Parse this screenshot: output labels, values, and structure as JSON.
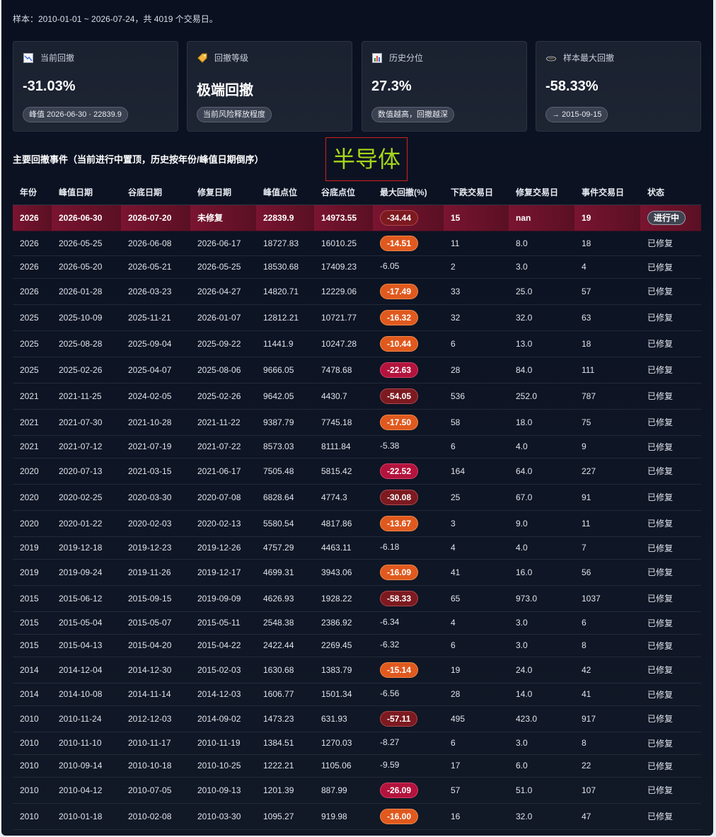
{
  "sample_text": "样本：2010-01-01 ~ 2026-07-24，共 4019 个交易日。",
  "cards": [
    {
      "title": "当前回撤",
      "icon": "chart-down-icon",
      "value": "-31.03%",
      "pill": "峰值 2026-06-30 · 22839.9"
    },
    {
      "title": "回撤等级",
      "icon": "tag-icon",
      "value": "极端回撤",
      "pill": "当前风险释放程度"
    },
    {
      "title": "历史分位",
      "icon": "bar-chart-icon",
      "value": "27.3%",
      "pill": "数值越高，回撤越深"
    },
    {
      "title": "样本最大回撤",
      "icon": "black-disc-icon",
      "value": "-58.33%",
      "pill": "→ 2015-09-15"
    }
  ],
  "section_title": "主要回撤事件（当前进行中置顶，历史按年份/峰值日期倒序）",
  "watermark": "半导体",
  "columns": [
    "年份",
    "峰值日期",
    "谷底日期",
    "修复日期",
    "峰值点位",
    "谷底点位",
    "最大回撤(%)",
    "下跌交易日",
    "修复交易日",
    "事件交易日",
    "状态"
  ],
  "rows": [
    {
      "year": "2026",
      "peak": "2026-06-30",
      "trough": "2026-07-20",
      "repair": "未修复",
      "peak_v": "22839.9",
      "trough_v": "14973.55",
      "dd": "-34.44",
      "dd_style": "dark",
      "down": "15",
      "rep": "nan",
      "evt": "19",
      "status": "进行中",
      "current": true
    },
    {
      "year": "2026",
      "peak": "2026-05-25",
      "trough": "2026-06-08",
      "repair": "2026-06-17",
      "peak_v": "18727.83",
      "trough_v": "16010.25",
      "dd": "-14.51",
      "dd_style": "orange",
      "down": "11",
      "rep": "8.0",
      "evt": "18",
      "status": "已修复"
    },
    {
      "year": "2026",
      "peak": "2026-05-20",
      "trough": "2026-05-21",
      "repair": "2026-05-25",
      "peak_v": "18530.68",
      "trough_v": "17409.23",
      "dd": "-6.05",
      "dd_style": "plain",
      "down": "2",
      "rep": "3.0",
      "evt": "4",
      "status": "已修复"
    },
    {
      "year": "2026",
      "peak": "2026-01-28",
      "trough": "2026-03-23",
      "repair": "2026-04-27",
      "peak_v": "14820.71",
      "trough_v": "12229.06",
      "dd": "-17.49",
      "dd_style": "orange",
      "down": "33",
      "rep": "25.0",
      "evt": "57",
      "status": "已修复"
    },
    {
      "year": "2025",
      "peak": "2025-10-09",
      "trough": "2025-11-21",
      "repair": "2026-01-07",
      "peak_v": "12812.21",
      "trough_v": "10721.77",
      "dd": "-16.32",
      "dd_style": "orange",
      "down": "32",
      "rep": "32.0",
      "evt": "63",
      "status": "已修复"
    },
    {
      "year": "2025",
      "peak": "2025-08-28",
      "trough": "2025-09-04",
      "repair": "2025-09-22",
      "peak_v": "11441.9",
      "trough_v": "10247.28",
      "dd": "-10.44",
      "dd_style": "orange",
      "down": "6",
      "rep": "13.0",
      "evt": "18",
      "status": "已修复"
    },
    {
      "year": "2025",
      "peak": "2025-02-26",
      "trough": "2025-04-07",
      "repair": "2025-08-06",
      "peak_v": "9666.05",
      "trough_v": "7478.68",
      "dd": "-22.63",
      "dd_style": "red",
      "down": "28",
      "rep": "84.0",
      "evt": "111",
      "status": "已修复"
    },
    {
      "year": "2021",
      "peak": "2021-11-25",
      "trough": "2024-02-05",
      "repair": "2025-02-26",
      "peak_v": "9642.05",
      "trough_v": "4430.7",
      "dd": "-54.05",
      "dd_style": "dark",
      "down": "536",
      "rep": "252.0",
      "evt": "787",
      "status": "已修复"
    },
    {
      "year": "2021",
      "peak": "2021-07-30",
      "trough": "2021-10-28",
      "repair": "2021-11-22",
      "peak_v": "9387.79",
      "trough_v": "7745.18",
      "dd": "-17.50",
      "dd_style": "orange",
      "down": "58",
      "rep": "18.0",
      "evt": "75",
      "status": "已修复"
    },
    {
      "year": "2021",
      "peak": "2021-07-12",
      "trough": "2021-07-19",
      "repair": "2021-07-22",
      "peak_v": "8573.03",
      "trough_v": "8111.84",
      "dd": "-5.38",
      "dd_style": "plain",
      "down": "6",
      "rep": "4.0",
      "evt": "9",
      "status": "已修复"
    },
    {
      "year": "2020",
      "peak": "2020-07-13",
      "trough": "2021-03-15",
      "repair": "2021-06-17",
      "peak_v": "7505.48",
      "trough_v": "5815.42",
      "dd": "-22.52",
      "dd_style": "red",
      "down": "164",
      "rep": "64.0",
      "evt": "227",
      "status": "已修复"
    },
    {
      "year": "2020",
      "peak": "2020-02-25",
      "trough": "2020-03-30",
      "repair": "2020-07-08",
      "peak_v": "6828.64",
      "trough_v": "4774.3",
      "dd": "-30.08",
      "dd_style": "dark",
      "down": "25",
      "rep": "67.0",
      "evt": "91",
      "status": "已修复"
    },
    {
      "year": "2020",
      "peak": "2020-01-22",
      "trough": "2020-02-03",
      "repair": "2020-02-13",
      "peak_v": "5580.54",
      "trough_v": "4817.86",
      "dd": "-13.67",
      "dd_style": "orange",
      "down": "3",
      "rep": "9.0",
      "evt": "11",
      "status": "已修复"
    },
    {
      "year": "2019",
      "peak": "2019-12-18",
      "trough": "2019-12-23",
      "repair": "2019-12-26",
      "peak_v": "4757.29",
      "trough_v": "4463.11",
      "dd": "-6.18",
      "dd_style": "plain",
      "down": "4",
      "rep": "4.0",
      "evt": "7",
      "status": "已修复"
    },
    {
      "year": "2019",
      "peak": "2019-09-24",
      "trough": "2019-11-26",
      "repair": "2019-12-17",
      "peak_v": "4699.31",
      "trough_v": "3943.06",
      "dd": "-16.09",
      "dd_style": "orange",
      "down": "41",
      "rep": "16.0",
      "evt": "56",
      "status": "已修复"
    },
    {
      "year": "2015",
      "peak": "2015-06-12",
      "trough": "2015-09-15",
      "repair": "2019-09-09",
      "peak_v": "4626.93",
      "trough_v": "1928.22",
      "dd": "-58.33",
      "dd_style": "dark",
      "down": "65",
      "rep": "973.0",
      "evt": "1037",
      "status": "已修复"
    },
    {
      "year": "2015",
      "peak": "2015-05-04",
      "trough": "2015-05-07",
      "repair": "2015-05-11",
      "peak_v": "2548.38",
      "trough_v": "2386.92",
      "dd": "-6.34",
      "dd_style": "plain",
      "down": "4",
      "rep": "3.0",
      "evt": "6",
      "status": "已修复"
    },
    {
      "year": "2015",
      "peak": "2015-04-13",
      "trough": "2015-04-20",
      "repair": "2015-04-22",
      "peak_v": "2422.44",
      "trough_v": "2269.45",
      "dd": "-6.32",
      "dd_style": "plain",
      "down": "6",
      "rep": "3.0",
      "evt": "8",
      "status": "已修复"
    },
    {
      "year": "2014",
      "peak": "2014-12-04",
      "trough": "2014-12-30",
      "repair": "2015-02-03",
      "peak_v": "1630.68",
      "trough_v": "1383.79",
      "dd": "-15.14",
      "dd_style": "orange",
      "down": "19",
      "rep": "24.0",
      "evt": "42",
      "status": "已修复"
    },
    {
      "year": "2014",
      "peak": "2014-10-08",
      "trough": "2014-11-14",
      "repair": "2014-12-03",
      "peak_v": "1606.77",
      "trough_v": "1501.34",
      "dd": "-6.56",
      "dd_style": "plain",
      "down": "28",
      "rep": "14.0",
      "evt": "41",
      "status": "已修复"
    },
    {
      "year": "2010",
      "peak": "2010-11-24",
      "trough": "2012-12-03",
      "repair": "2014-09-02",
      "peak_v": "1473.23",
      "trough_v": "631.93",
      "dd": "-57.11",
      "dd_style": "dark",
      "down": "495",
      "rep": "423.0",
      "evt": "917",
      "status": "已修复"
    },
    {
      "year": "2010",
      "peak": "2010-11-10",
      "trough": "2010-11-17",
      "repair": "2010-11-19",
      "peak_v": "1384.51",
      "trough_v": "1270.03",
      "dd": "-8.27",
      "dd_style": "plain",
      "down": "6",
      "rep": "3.0",
      "evt": "8",
      "status": "已修复"
    },
    {
      "year": "2010",
      "peak": "2010-09-14",
      "trough": "2010-10-18",
      "repair": "2010-10-25",
      "peak_v": "1222.21",
      "trough_v": "1105.06",
      "dd": "-9.59",
      "dd_style": "plain",
      "down": "17",
      "rep": "6.0",
      "evt": "22",
      "status": "已修复"
    },
    {
      "year": "2010",
      "peak": "2010-04-12",
      "trough": "2010-07-05",
      "repair": "2010-09-13",
      "peak_v": "1201.39",
      "trough_v": "887.99",
      "dd": "-26.09",
      "dd_style": "red",
      "down": "57",
      "rep": "51.0",
      "evt": "107",
      "status": "已修复"
    },
    {
      "year": "2010",
      "peak": "2010-01-18",
      "trough": "2010-02-08",
      "repair": "2010-03-30",
      "peak_v": "1095.27",
      "trough_v": "919.98",
      "dd": "-16.00",
      "dd_style": "orange",
      "down": "16",
      "rep": "32.0",
      "evt": "47",
      "status": "已修复"
    }
  ]
}
